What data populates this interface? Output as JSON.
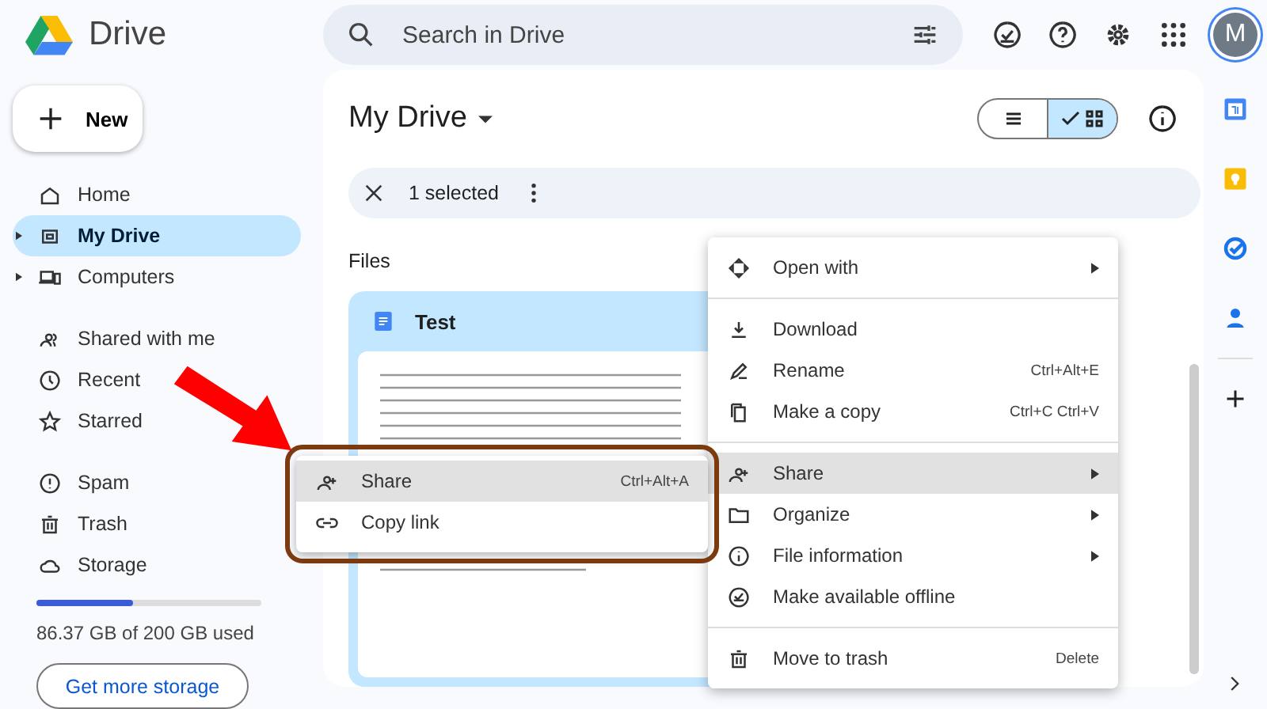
{
  "app": {
    "name": "Drive"
  },
  "search": {
    "placeholder": "Search in Drive"
  },
  "avatar": {
    "initial": "M"
  },
  "new_button": {
    "label": "New"
  },
  "sidebar": {
    "groups": [
      [
        {
          "label": "Home",
          "selected": false,
          "expandable": false
        },
        {
          "label": "My Drive",
          "selected": true,
          "expandable": true
        },
        {
          "label": "Computers",
          "selected": false,
          "expandable": true
        }
      ],
      [
        {
          "label": "Shared with me",
          "selected": false,
          "expandable": false
        },
        {
          "label": "Recent",
          "selected": false,
          "expandable": false
        },
        {
          "label": "Starred",
          "selected": false,
          "expandable": false
        }
      ],
      [
        {
          "label": "Spam",
          "selected": false,
          "expandable": false
        },
        {
          "label": "Trash",
          "selected": false,
          "expandable": false
        },
        {
          "label": "Storage",
          "selected": false,
          "expandable": false
        }
      ]
    ]
  },
  "storage": {
    "level": 0.43,
    "usage": "86.37 GB of 200 GB used",
    "button": "Get more storage"
  },
  "main": {
    "title": "My Drive",
    "view_modes": [
      {
        "selected": false
      },
      {
        "selected": true
      }
    ],
    "selection": "1 selected",
    "section": "Files",
    "file": {
      "name": "Test"
    }
  },
  "context_menu": [
    {
      "kind": "item",
      "label": "Open with",
      "submenu": true,
      "selected": false
    },
    {
      "kind": "separator"
    },
    {
      "kind": "item",
      "label": "Download",
      "submenu": false,
      "selected": false
    },
    {
      "kind": "item",
      "label": "Rename",
      "shortcut": "Ctrl+Alt+E",
      "submenu": false,
      "selected": false
    },
    {
      "kind": "item",
      "label": "Make a copy",
      "shortcut": "Ctrl+C Ctrl+V",
      "submenu": false,
      "selected": false
    },
    {
      "kind": "separator"
    },
    {
      "kind": "item",
      "label": "Share",
      "submenu": true,
      "selected": true
    },
    {
      "kind": "item",
      "label": "Organize",
      "submenu": true,
      "selected": false
    },
    {
      "kind": "item",
      "label": "File information",
      "submenu": true,
      "selected": false
    },
    {
      "kind": "item",
      "label": "Make available offline",
      "submenu": false,
      "selected": false
    },
    {
      "kind": "separator"
    },
    {
      "kind": "item",
      "label": "Move to trash",
      "shortcut": "Delete",
      "submenu": false,
      "selected": false
    }
  ],
  "share_submenu": [
    {
      "label": "Share",
      "shortcut": "Ctrl+Alt+A",
      "selected": true
    },
    {
      "label": "Copy link",
      "selected": false
    }
  ]
}
